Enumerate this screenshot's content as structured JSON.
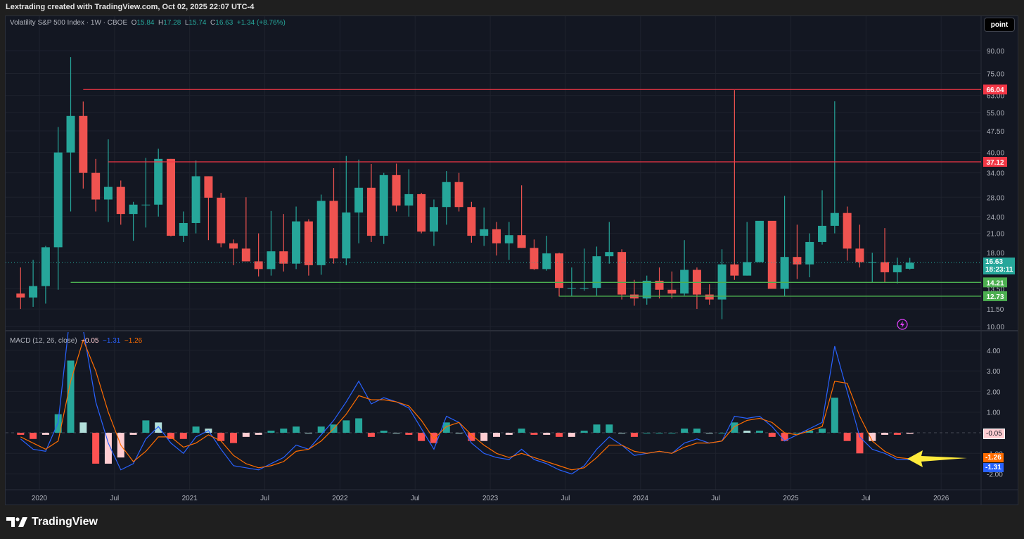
{
  "header": {
    "attribution": "Lextrading created with TradingView.com, Oct 02, 2025 22:07 UTC-4"
  },
  "legend": {
    "symbol": "Volatility S&P 500 Index · 1W · CBOE",
    "open_label": "O",
    "open": "15.84",
    "high_label": "H",
    "high": "17.28",
    "low_label": "L",
    "low": "15.74",
    "close_label": "C",
    "close": "16.63",
    "change": "+1.34 (+8.76%)"
  },
  "toolbar": {
    "point_label": "point"
  },
  "macd_legend": {
    "title": "MACD (12, 26, close)",
    "hist": "−0.05",
    "macd": "−1.31",
    "signal": "−1.26"
  },
  "footer": {
    "brand": "TradingView"
  },
  "colors": {
    "up": "#26a69a",
    "down": "#ef5350",
    "resistance": "#f23645",
    "support": "#4caf50",
    "macd": "#2962ff",
    "signal": "#ff6d00",
    "arrow": "#ffeb3b"
  },
  "price_tags": {
    "last": "16.63",
    "countdown": "18:23:11",
    "hist": "-0.05",
    "signal": "-1.26",
    "macd": "-1.31"
  },
  "chart_data": {
    "type": "candlestick",
    "title": "Volatility S&P 500 Index · 1W · CBOE",
    "y_scale": "log",
    "ylim": [
      10,
      90
    ],
    "price_ticks": [
      10,
      11.5,
      13.5,
      18,
      21,
      24,
      28,
      34,
      40,
      47.5,
      55,
      63,
      75,
      90
    ],
    "x_ticks": [
      {
        "label": "2020",
        "t": 2020
      },
      {
        "label": "Jul",
        "t": 2020.5
      },
      {
        "label": "2021",
        "t": 2021
      },
      {
        "label": "Jul",
        "t": 2021.5
      },
      {
        "label": "2022",
        "t": 2022
      },
      {
        "label": "Jul",
        "t": 2022.5
      },
      {
        "label": "2023",
        "t": 2023
      },
      {
        "label": "Jul",
        "t": 2023.5
      },
      {
        "label": "2024",
        "t": 2024
      },
      {
        "label": "Jul",
        "t": 2024.5
      },
      {
        "label": "2025",
        "t": 2025
      },
      {
        "label": "Jul",
        "t": 2025.5
      },
      {
        "label": "2026",
        "t": 2026
      }
    ],
    "levels": [
      {
        "price": 66.04,
        "label": "66.04",
        "kind": "resistance",
        "from": "2020-04"
      },
      {
        "price": 37.12,
        "label": "37.12",
        "kind": "resistance",
        "from": "2020-06"
      },
      {
        "price": 14.21,
        "label": "14.21",
        "kind": "support",
        "from": "2020-03"
      },
      {
        "price": 12.73,
        "label": "12.73",
        "kind": "support",
        "from": "2023-06"
      }
    ],
    "macd_ticks": [
      4,
      3,
      2,
      1,
      -1,
      -2
    ],
    "macd_ylim": [
      -2.6,
      4.8
    ],
    "candles": [
      {
        "d": "2019-11",
        "o": 13,
        "h": 16,
        "l": 11.5,
        "c": 12.6,
        "m": -0.3,
        "s": -0.2
      },
      {
        "d": "2019-12",
        "o": 12.6,
        "h": 17,
        "l": 11.7,
        "c": 13.8,
        "m": -0.8,
        "s": -0.5
      },
      {
        "d": "2020-01",
        "o": 13.8,
        "h": 19,
        "l": 12,
        "c": 18.8,
        "m": -0.9,
        "s": -0.8
      },
      {
        "d": "2020-02",
        "o": 18.8,
        "h": 49,
        "l": 13.4,
        "c": 40,
        "m": 0.5,
        "s": -0.4
      },
      {
        "d": "2020-03",
        "o": 40,
        "h": 85.5,
        "l": 25,
        "c": 53.5,
        "m": 6,
        "s": 2.5
      },
      {
        "d": "2020-04",
        "o": 53.5,
        "h": 60,
        "l": 30,
        "c": 34,
        "m": 5,
        "s": 4.5
      },
      {
        "d": "2020-05",
        "o": 34,
        "h": 38,
        "l": 25,
        "c": 27.5,
        "m": 1.5,
        "s": 3.0
      },
      {
        "d": "2020-06",
        "o": 27.5,
        "h": 44.4,
        "l": 23,
        "c": 30.4,
        "m": -0.5,
        "s": 1.0
      },
      {
        "d": "2020-07",
        "o": 30.4,
        "h": 32,
        "l": 22.5,
        "c": 24.5,
        "m": -1.8,
        "s": -0.6
      },
      {
        "d": "2020-08",
        "o": 24.5,
        "h": 27,
        "l": 19.8,
        "c": 26.4,
        "m": -1.5,
        "s": -1.4
      },
      {
        "d": "2020-09",
        "o": 26.4,
        "h": 38.3,
        "l": 22,
        "c": 26.4,
        "m": -0.3,
        "s": -0.9
      },
      {
        "d": "2020-10",
        "o": 26.4,
        "h": 41.2,
        "l": 24,
        "c": 38,
        "m": 0.3,
        "s": -0.2
      },
      {
        "d": "2020-11",
        "o": 38,
        "h": 38,
        "l": 20.5,
        "c": 20.6,
        "m": -0.5,
        "s": -0.2
      },
      {
        "d": "2020-12",
        "o": 20.6,
        "h": 25,
        "l": 19.6,
        "c": 22.8,
        "m": -1.0,
        "s": -0.7
      },
      {
        "d": "2021-01",
        "o": 22.8,
        "h": 37.5,
        "l": 21,
        "c": 33.1,
        "m": -0.2,
        "s": -0.5
      },
      {
        "d": "2021-02",
        "o": 33.1,
        "h": 33.1,
        "l": 19.9,
        "c": 27.9,
        "m": 0.1,
        "s": -0.1
      },
      {
        "d": "2021-03",
        "o": 27.9,
        "h": 29,
        "l": 18.8,
        "c": 19.4,
        "m": -0.8,
        "s": -0.4
      },
      {
        "d": "2021-04",
        "o": 19.4,
        "h": 20,
        "l": 16.3,
        "c": 18.6,
        "m": -1.6,
        "s": -1.1
      },
      {
        "d": "2021-05",
        "o": 18.6,
        "h": 28,
        "l": 16.8,
        "c": 16.8,
        "m": -1.7,
        "s": -1.5
      },
      {
        "d": "2021-06",
        "o": 16.8,
        "h": 21,
        "l": 14.9,
        "c": 15.8,
        "m": -1.8,
        "s": -1.7
      },
      {
        "d": "2021-07",
        "o": 15.8,
        "h": 25.1,
        "l": 15,
        "c": 18.2,
        "m": -1.5,
        "s": -1.6
      },
      {
        "d": "2021-08",
        "o": 18.2,
        "h": 24.5,
        "l": 15.5,
        "c": 16.5,
        "m": -1.2,
        "s": -1.4
      },
      {
        "d": "2021-09",
        "o": 16.5,
        "h": 26,
        "l": 15.8,
        "c": 23.1,
        "m": -0.6,
        "s": -0.9
      },
      {
        "d": "2021-10",
        "o": 23.1,
        "h": 23.5,
        "l": 15,
        "c": 16.3,
        "m": -0.8,
        "s": -0.8
      },
      {
        "d": "2021-11",
        "o": 16.3,
        "h": 28.6,
        "l": 15.1,
        "c": 27.2,
        "m": -0.1,
        "s": -0.4
      },
      {
        "d": "2021-12",
        "o": 27.2,
        "h": 35.3,
        "l": 16.5,
        "c": 17.2,
        "m": 0.6,
        "s": 0.2
      },
      {
        "d": "2022-01",
        "o": 17.2,
        "h": 38.9,
        "l": 16.3,
        "c": 24.8,
        "m": 1.5,
        "s": 0.9
      },
      {
        "d": "2022-02",
        "o": 24.8,
        "h": 37.8,
        "l": 19.4,
        "c": 30.2,
        "m": 2.5,
        "s": 1.8
      },
      {
        "d": "2022-03",
        "o": 30.2,
        "h": 36.5,
        "l": 19.6,
        "c": 20.6,
        "m": 1.4,
        "s": 1.6
      },
      {
        "d": "2022-04",
        "o": 20.6,
        "h": 34,
        "l": 19.3,
        "c": 33.4,
        "m": 1.7,
        "s": 1.6
      },
      {
        "d": "2022-05",
        "o": 33.4,
        "h": 36.6,
        "l": 25,
        "c": 26.2,
        "m": 1.5,
        "s": 1.5
      },
      {
        "d": "2022-06",
        "o": 26.2,
        "h": 35,
        "l": 24,
        "c": 28.7,
        "m": 1.2,
        "s": 1.3
      },
      {
        "d": "2022-07",
        "o": 28.7,
        "h": 29,
        "l": 21,
        "c": 21.3,
        "m": 0.2,
        "s": 0.6
      },
      {
        "d": "2022-08",
        "o": 21.3,
        "h": 27.5,
        "l": 19,
        "c": 25.9,
        "m": -0.8,
        "s": -0.3
      },
      {
        "d": "2022-09",
        "o": 25.9,
        "h": 34.5,
        "l": 22.5,
        "c": 31.6,
        "m": 0.8,
        "s": 0.3
      },
      {
        "d": "2022-10",
        "o": 31.6,
        "h": 34,
        "l": 25,
        "c": 25.9,
        "m": 0.5,
        "s": 0.5
      },
      {
        "d": "2022-11",
        "o": 25.9,
        "h": 27,
        "l": 19.5,
        "c": 20.6,
        "m": -0.5,
        "s": -0.1
      },
      {
        "d": "2022-12",
        "o": 20.6,
        "h": 25.8,
        "l": 19,
        "c": 21.7,
        "m": -1.0,
        "s": -0.6
      },
      {
        "d": "2023-01",
        "o": 21.7,
        "h": 23,
        "l": 17.6,
        "c": 19.4,
        "m": -1.2,
        "s": -1.0
      },
      {
        "d": "2023-02",
        "o": 19.4,
        "h": 23,
        "l": 17,
        "c": 20.7,
        "m": -1.3,
        "s": -1.2
      },
      {
        "d": "2023-03",
        "o": 20.7,
        "h": 30.8,
        "l": 18.7,
        "c": 18.7,
        "m": -0.8,
        "s": -1.0
      },
      {
        "d": "2023-04",
        "o": 18.7,
        "h": 20,
        "l": 15.7,
        "c": 15.8,
        "m": -1.3,
        "s": -1.2
      },
      {
        "d": "2023-05",
        "o": 15.8,
        "h": 20.6,
        "l": 15.6,
        "c": 17.9,
        "m": -1.5,
        "s": -1.4
      },
      {
        "d": "2023-06",
        "o": 17.9,
        "h": 18,
        "l": 12.7,
        "c": 13.6,
        "m": -1.8,
        "s": -1.6
      },
      {
        "d": "2023-07",
        "o": 13.6,
        "h": 16,
        "l": 12.7,
        "c": 13.6,
        "m": -2.0,
        "s": -1.8
      },
      {
        "d": "2023-08",
        "o": 13.6,
        "h": 18.6,
        "l": 13.3,
        "c": 13.6,
        "m": -1.6,
        "s": -1.7
      },
      {
        "d": "2023-09",
        "o": 13.6,
        "h": 18.9,
        "l": 12.8,
        "c": 17.5,
        "m": -0.8,
        "s": -1.2
      },
      {
        "d": "2023-10",
        "o": 17.5,
        "h": 23,
        "l": 16.5,
        "c": 18.1,
        "m": -0.2,
        "s": -0.6
      },
      {
        "d": "2023-11",
        "o": 18.1,
        "h": 18.5,
        "l": 12.4,
        "c": 12.9,
        "m": -0.6,
        "s": -0.6
      },
      {
        "d": "2023-12",
        "o": 12.9,
        "h": 14.5,
        "l": 11.8,
        "c": 12.5,
        "m": -1.1,
        "s": -0.9
      },
      {
        "d": "2024-01",
        "o": 12.5,
        "h": 15,
        "l": 11.9,
        "c": 14.4,
        "m": -1.0,
        "s": -1.0
      },
      {
        "d": "2024-02",
        "o": 14.4,
        "h": 16,
        "l": 12.5,
        "c": 13.4,
        "m": -0.9,
        "s": -0.9
      },
      {
        "d": "2024-03",
        "o": 13.4,
        "h": 15.5,
        "l": 12.5,
        "c": 13,
        "m": -1.0,
        "s": -1.0
      },
      {
        "d": "2024-04",
        "o": 13,
        "h": 19.9,
        "l": 12.8,
        "c": 15.7,
        "m": -0.5,
        "s": -0.7
      },
      {
        "d": "2024-05",
        "o": 15.7,
        "h": 16,
        "l": 11.5,
        "c": 12.9,
        "m": -0.3,
        "s": -0.5
      },
      {
        "d": "2024-06",
        "o": 12.9,
        "h": 14,
        "l": 11.9,
        "c": 12.4,
        "m": -0.5,
        "s": -0.5
      },
      {
        "d": "2024-07",
        "o": 12.4,
        "h": 18.5,
        "l": 10.6,
        "c": 16.4,
        "m": -0.4,
        "s": -0.4
      },
      {
        "d": "2024-08",
        "o": 16.4,
        "h": 65.7,
        "l": 14.5,
        "c": 15,
        "m": 0.8,
        "s": 0.3
      },
      {
        "d": "2024-09",
        "o": 15,
        "h": 23,
        "l": 15,
        "c": 16.7,
        "m": 0.7,
        "s": 0.6
      },
      {
        "d": "2024-10",
        "o": 16.7,
        "h": 23.1,
        "l": 17,
        "c": 23.2,
        "m": 0.8,
        "s": 0.7
      },
      {
        "d": "2024-11",
        "o": 23.2,
        "h": 22.5,
        "l": 13.5,
        "c": 13.5,
        "m": 0.3,
        "s": 0.5
      },
      {
        "d": "2024-12",
        "o": 13.5,
        "h": 28.3,
        "l": 12.7,
        "c": 17.4,
        "m": -0.4,
        "s": 0.0
      },
      {
        "d": "2025-01",
        "o": 17.4,
        "h": 22.5,
        "l": 14.6,
        "c": 16.4,
        "m": -0.1,
        "s": -0.1
      },
      {
        "d": "2025-02",
        "o": 16.4,
        "h": 21,
        "l": 14.8,
        "c": 19.6,
        "m": 0.2,
        "s": 0.1
      },
      {
        "d": "2025-03",
        "o": 19.6,
        "h": 29.6,
        "l": 19.2,
        "c": 22.3,
        "m": 0.5,
        "s": 0.3
      },
      {
        "d": "2025-04",
        "o": 22.3,
        "h": 60.1,
        "l": 21,
        "c": 24.7,
        "m": 4.2,
        "s": 2.5
      },
      {
        "d": "2025-05",
        "o": 24.7,
        "h": 26,
        "l": 16.9,
        "c": 18.6,
        "m": 2.0,
        "s": 2.4
      },
      {
        "d": "2025-06",
        "o": 18.6,
        "h": 22.5,
        "l": 16,
        "c": 16.7,
        "m": -0.2,
        "s": 0.8
      },
      {
        "d": "2025-07",
        "o": 16.7,
        "h": 18,
        "l": 14.2,
        "c": 16.7,
        "m": -0.8,
        "s": -0.4
      },
      {
        "d": "2025-08",
        "o": 16.7,
        "h": 21.9,
        "l": 14.2,
        "c": 15.4,
        "m": -1.0,
        "s": -0.9
      },
      {
        "d": "2025-09",
        "o": 15.4,
        "h": 17.3,
        "l": 14.1,
        "c": 16.3,
        "m": -1.3,
        "s": -1.2
      },
      {
        "d": "2025-10",
        "o": 15.84,
        "h": 17.28,
        "l": 15.74,
        "c": 16.63,
        "m": -1.31,
        "s": -1.26
      }
    ]
  }
}
